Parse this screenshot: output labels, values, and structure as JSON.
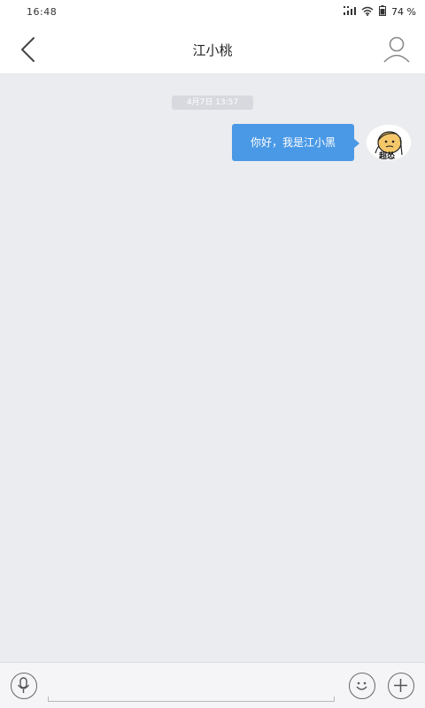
{
  "status": {
    "time": "16:48",
    "battery_text": "74 %"
  },
  "header": {
    "title": "江小桃"
  },
  "chat": {
    "date_label": "4月7日 13:57",
    "messages": [
      {
        "text": "你好，我是江小黑",
        "sender": "self",
        "avatar_label": "超怂"
      }
    ]
  },
  "input": {
    "placeholder": ""
  },
  "icons": {
    "back": "chevron-left-icon",
    "profile": "person-icon",
    "voice": "microphone-icon",
    "emoji": "smiley-icon",
    "more": "plus-icon"
  },
  "colors": {
    "bubble": "#4a99e6",
    "background": "#ebecef"
  }
}
